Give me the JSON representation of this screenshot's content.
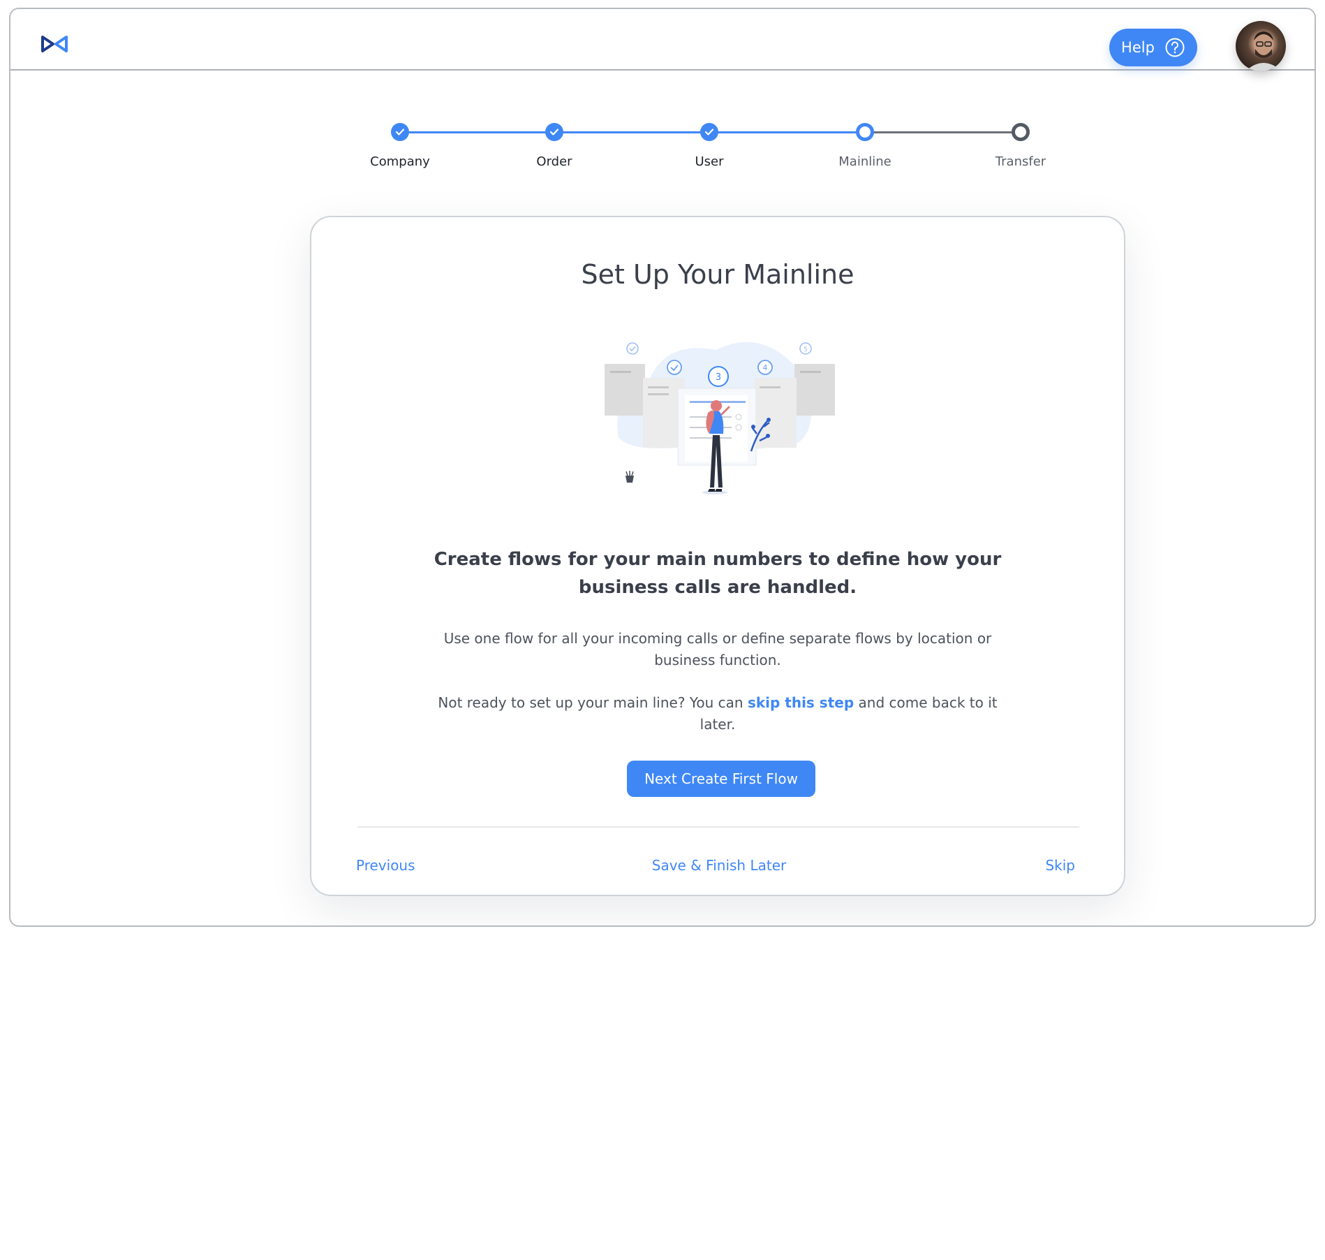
{
  "header": {
    "help_label": "Help",
    "icons": {
      "logo": "bowtie-logo-icon",
      "help": "question-circle-icon",
      "avatar": "user-avatar"
    }
  },
  "stepper": {
    "steps": [
      {
        "label": "Company",
        "state": "done"
      },
      {
        "label": "Order",
        "state": "done"
      },
      {
        "label": "User",
        "state": "done"
      },
      {
        "label": "Mainline",
        "state": "current"
      },
      {
        "label": "Transfer",
        "state": "todo"
      }
    ]
  },
  "card": {
    "title": "Set Up Your Mainline",
    "illustration_badges": [
      "3",
      "4",
      "5"
    ],
    "headline": "Create flows for your main numbers to define how your business calls are handled.",
    "paragraph1": "Use one flow for all your incoming calls or define separate flows by location or business function.",
    "paragraph2_before": "Not ready to set up your main line? You can ",
    "paragraph2_link": "skip this step",
    "paragraph2_after": " and come back to it later.",
    "primary_button": "Next Create First Flow",
    "footer": {
      "previous": "Previous",
      "save_later": "Save & Finish Later",
      "skip": "Skip"
    }
  },
  "colors": {
    "accent": "#3f87f5",
    "text": "#3a3f4b",
    "todo_step": "#545a63",
    "border": "#b7bbc0"
  }
}
